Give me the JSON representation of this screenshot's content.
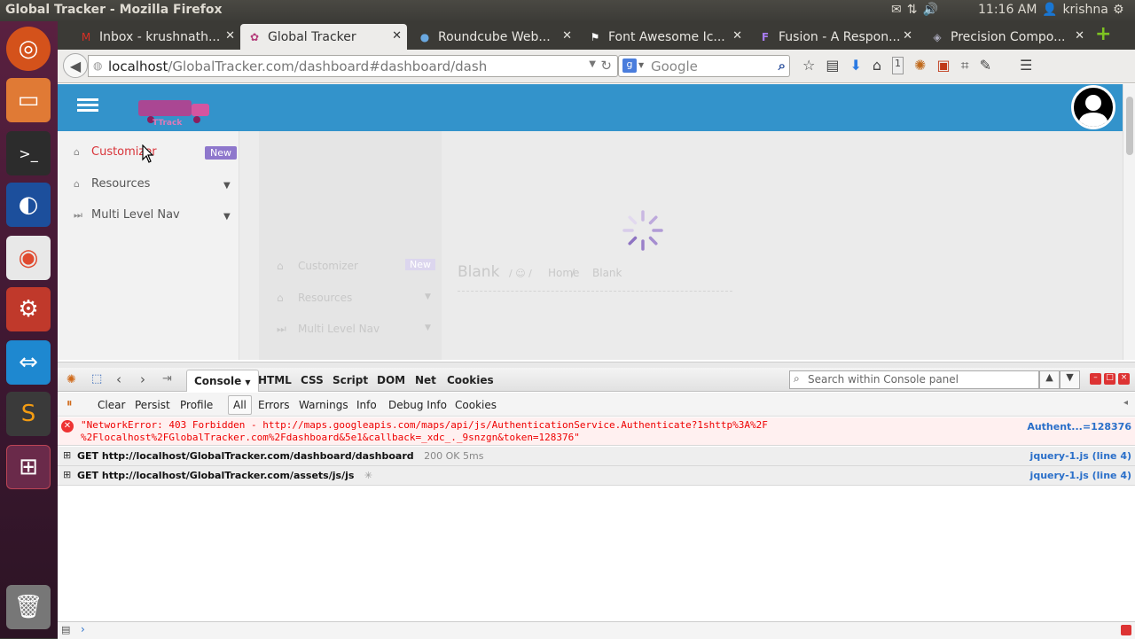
{
  "os": {
    "window_title": "Global Tracker - Mozilla Firefox",
    "clock": "11:16 AM",
    "user": "krishna"
  },
  "browser": {
    "tabs": [
      {
        "label": "Inbox - krushnath...",
        "icon": "gmail-icon"
      },
      {
        "label": "Global Tracker",
        "icon": "tracker-icon"
      },
      {
        "label": "Roundcube Web...",
        "icon": "roundcube-icon"
      },
      {
        "label": "Font Awesome Ic...",
        "icon": "flag-icon"
      },
      {
        "label": "Fusion - A Respon...",
        "icon": "fusion-icon"
      },
      {
        "label": "Precision Compo...",
        "icon": "precision-icon"
      }
    ],
    "url_domain": "localhost",
    "url_path": "/GlobalTracker.com/dashboard#dashboard/dash",
    "search_placeholder": "Google",
    "notification_count": "1"
  },
  "app": {
    "logo_text": "TTrack",
    "sidebar": [
      {
        "label": "Customizer",
        "badge": "New",
        "active": true
      },
      {
        "label": "Resources",
        "badge": "",
        "active": false
      },
      {
        "label": "Multi Level Nav",
        "badge": "",
        "active": false
      }
    ],
    "ghost": {
      "title": "Blank",
      "crumb_home": "Home",
      "crumb_current": "Blank"
    }
  },
  "firebug": {
    "tabs": [
      "Console",
      "HTML",
      "CSS",
      "Script",
      "DOM",
      "Net",
      "Cookies"
    ],
    "search_placeholder": "Search within Console panel",
    "actions": [
      "Clear",
      "Persist",
      "Profile"
    ],
    "filters": [
      "All",
      "Errors",
      "Warnings",
      "Info",
      "Debug Info",
      "Cookies"
    ],
    "log": [
      {
        "type": "error",
        "line1": "\"NetworkError: 403 Forbidden - http://maps.googleapis.com/maps/api/js/AuthenticationService.Authenticate?1shttp%3A%2F",
        "line2": "%2Flocalhost%2FGlobalTracker.com%2Fdashboard&5e1&callback=_xdc_._9snzgn&token=128376\"",
        "source": "Authent...=128376"
      },
      {
        "type": "net",
        "text": "GET http://localhost/GlobalTracker.com/dashboard/dashboard",
        "status": "200 OK 5ms",
        "source": "jquery-1.js (line 4)"
      },
      {
        "type": "net",
        "text": "GET http://localhost/GlobalTracker.com/assets/js/js",
        "status": "",
        "source": "jquery-1.js (line 4)"
      }
    ]
  },
  "colors": {
    "header": "#3393cb",
    "active_nav": "#d9343a",
    "badge": "#8e77cc",
    "error_bg": "#fff0f0"
  }
}
